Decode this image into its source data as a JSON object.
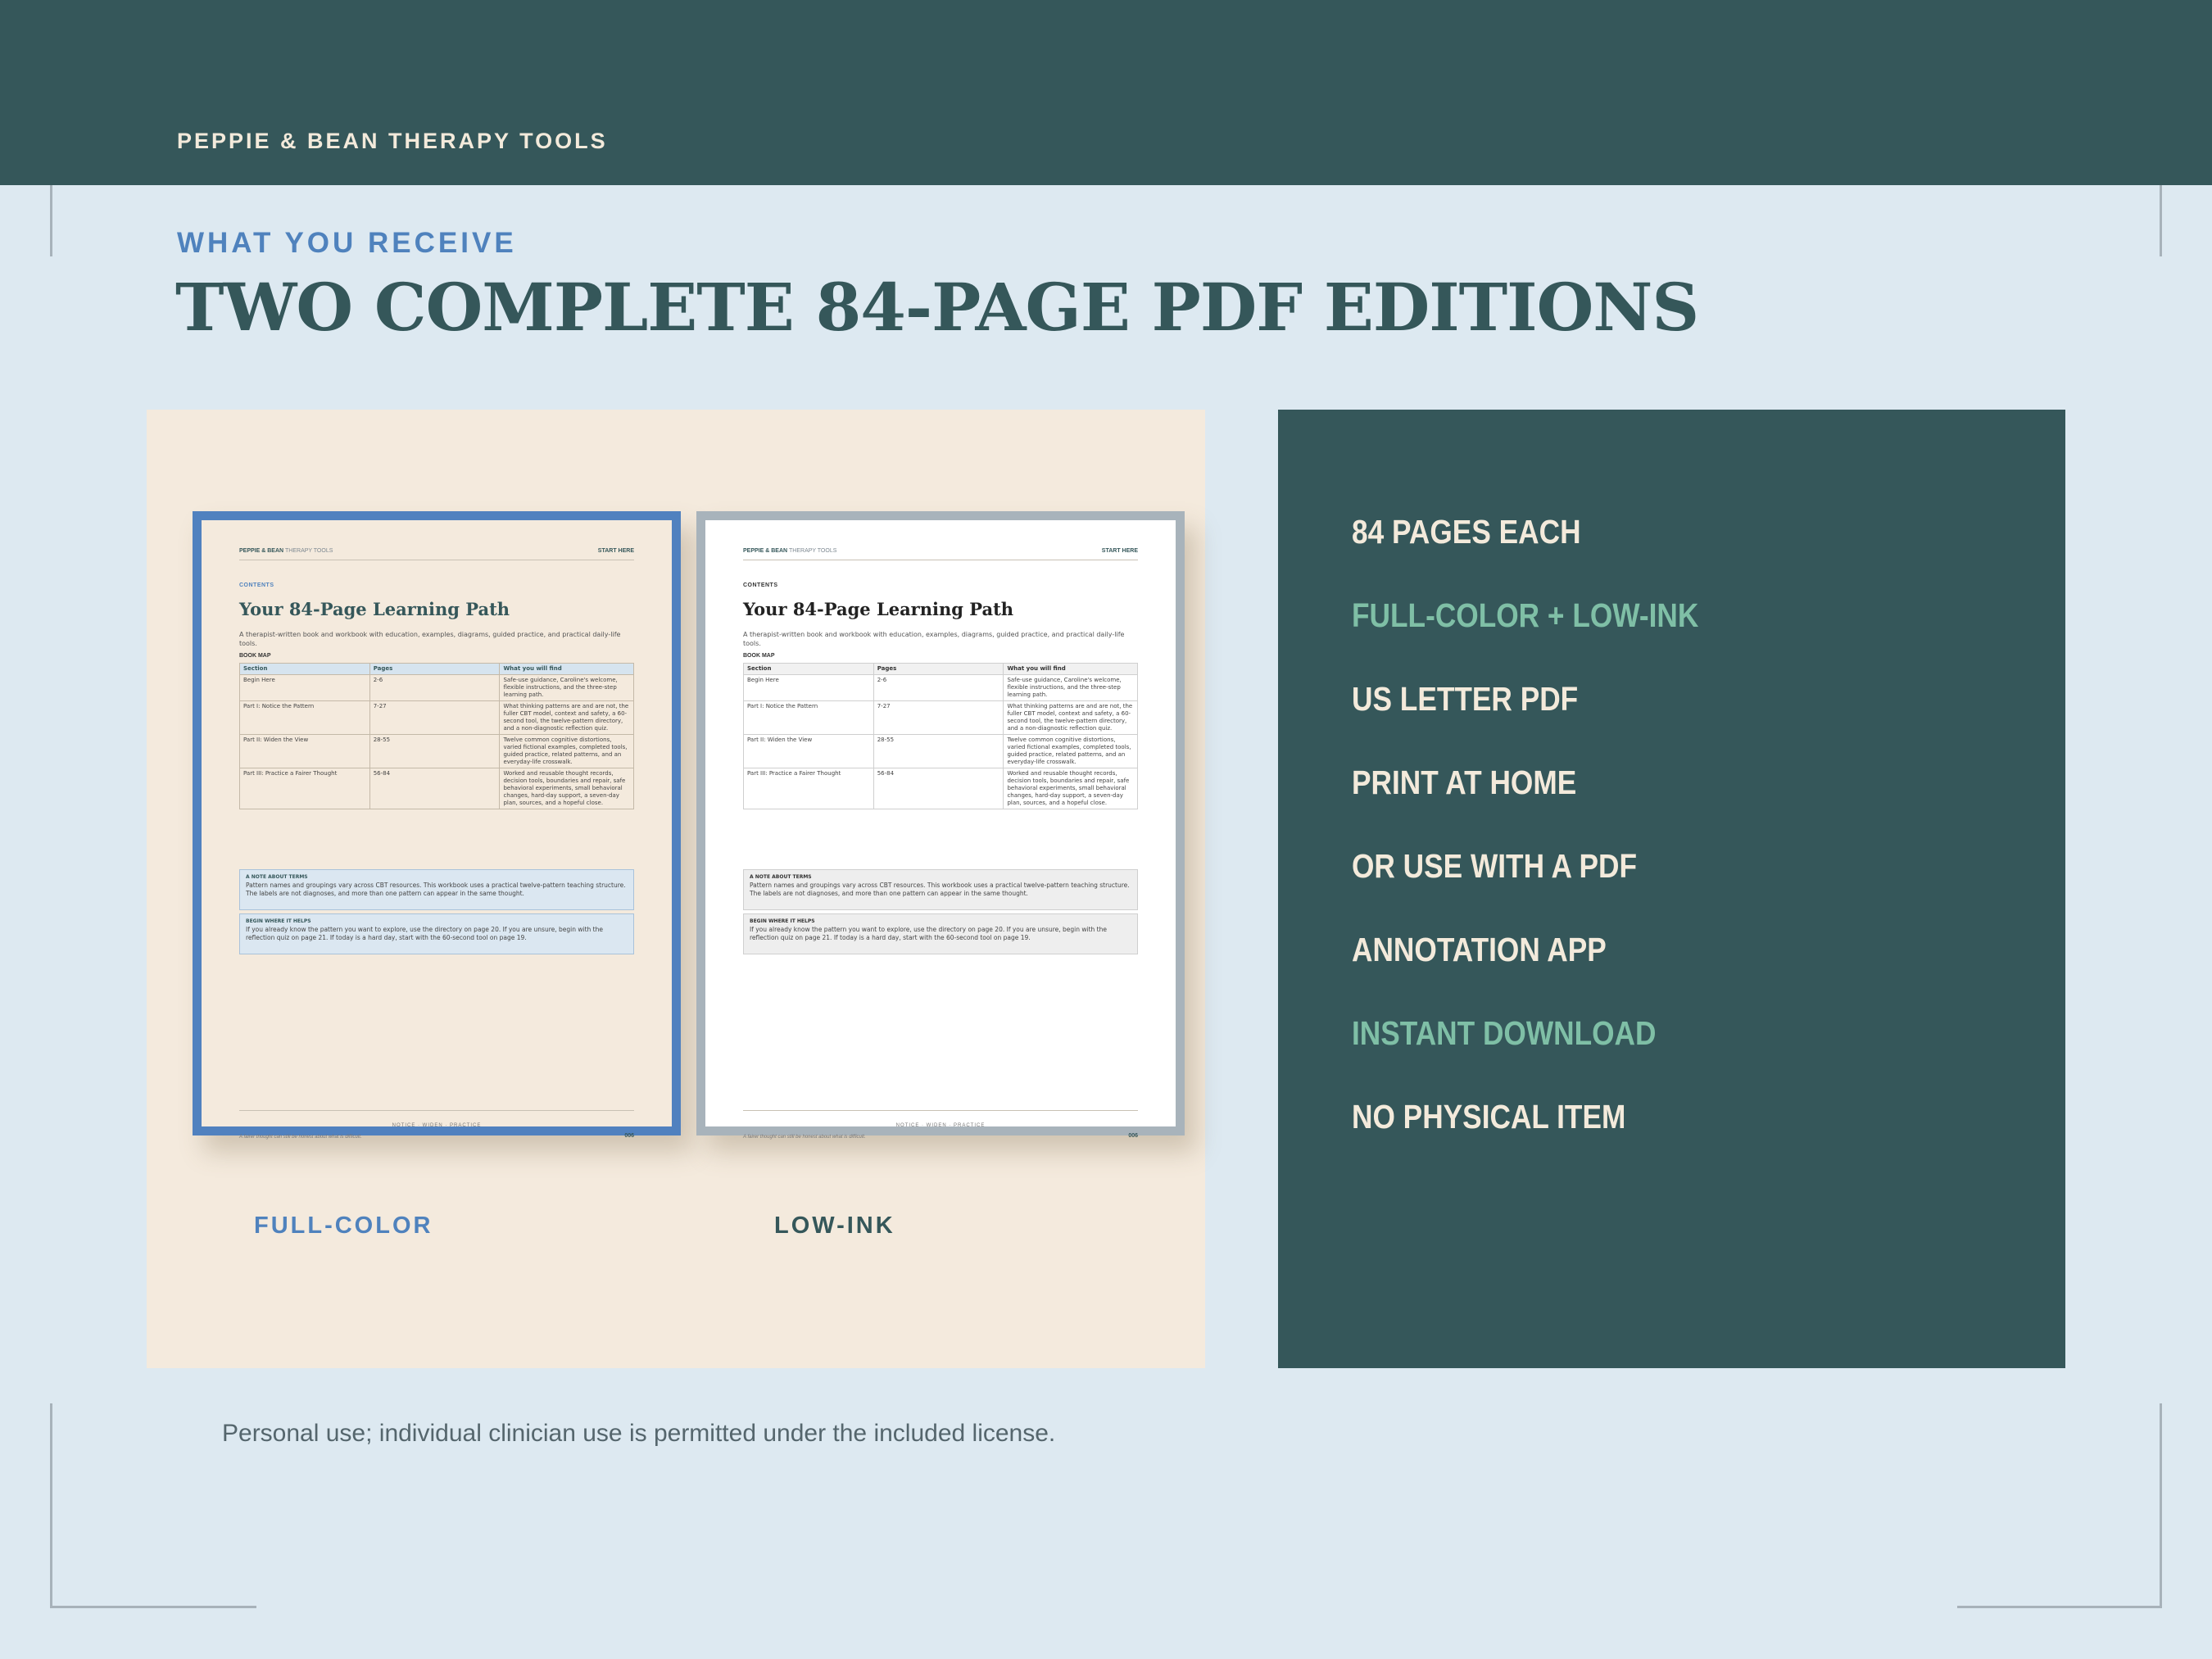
{
  "brand": "PEPPIE & BEAN THERAPY TOOLS",
  "eyebrow": "WHAT YOU RECEIVE",
  "headline": "TWO COMPLETE 84-PAGE PDF EDITIONS",
  "colors": {
    "dark_teal": "#35575a",
    "blue": "#4f82bd",
    "mint": "#7fbfa6",
    "cream": "#f3eadb",
    "background": "#dde9f1",
    "panel": "#f4eadd"
  },
  "preview_page": {
    "brand": "PEPPIE & BEAN",
    "brand_sub": "THERAPY TOOLS",
    "start": "START HERE",
    "label": "CONTENTS",
    "title": "Your 84-Page Learning Path",
    "intro": "A therapist-written book and workbook with education, examples, diagrams, guided practice, and practical daily-life tools.",
    "map_label": "BOOK MAP",
    "table_headers": [
      "Section",
      "Pages",
      "What you will find"
    ],
    "table_rows": [
      [
        "Begin Here",
        "2-6",
        "Safe-use guidance, Caroline's welcome, flexible instructions, and the three-step learning path."
      ],
      [
        "Part I: Notice the Pattern",
        "7-27",
        "What thinking patterns are and are not, the fuller CBT model, context and safety, a 60-second tool, the twelve-pattern directory, and a non-diagnostic reflection quiz."
      ],
      [
        "Part II: Widen the View",
        "28-55",
        "Twelve common cognitive distortions, varied fictional examples, completed tools, guided practice, related patterns, and an everyday-life crosswalk."
      ],
      [
        "Part III: Practice a Fairer Thought",
        "56-84",
        "Worked and reusable thought records, decision tools, boundaries and repair, safe behavioral experiments, small behavioral changes, hard-day support, a seven-day plan, sources, and a hopeful close."
      ]
    ],
    "note1_heading": "A NOTE ABOUT TERMS",
    "note1_text": "Pattern names and groupings vary across CBT resources. This workbook uses a practical twelve-pattern teaching structure. The labels are not diagnoses, and more than one pattern can appear in the same thought.",
    "note2_heading": "BEGIN WHERE IT HELPS",
    "note2_text": "If you already know the pattern you want to explore, use the directory on page 20. If you are unsure, begin with the reflection quiz on page 21. If today is a hard day, start with the 60-second tool on page 19.",
    "footer_mid": "NOTICE · WIDEN · PRACTICE",
    "footer_left": "A fairer thought can still be honest about what is difficult.",
    "page_number": "006"
  },
  "editions": {
    "color_label": "FULL-COLOR",
    "mono_label": "LOW-INK"
  },
  "features": [
    {
      "text": "84 PAGES EACH",
      "accent": false
    },
    {
      "text": "FULL-COLOR + LOW-INK",
      "accent": true
    },
    {
      "text": "US LETTER PDF",
      "accent": false
    },
    {
      "text": "PRINT AT HOME",
      "accent": false
    },
    {
      "text": "OR USE WITH A PDF",
      "accent": false
    },
    {
      "text": "ANNOTATION APP",
      "accent": false
    },
    {
      "text": "INSTANT DOWNLOAD",
      "accent": true
    },
    {
      "text": "NO PHYSICAL ITEM",
      "accent": false
    }
  ],
  "license": "Personal use; individual clinician use is permitted under the included license."
}
